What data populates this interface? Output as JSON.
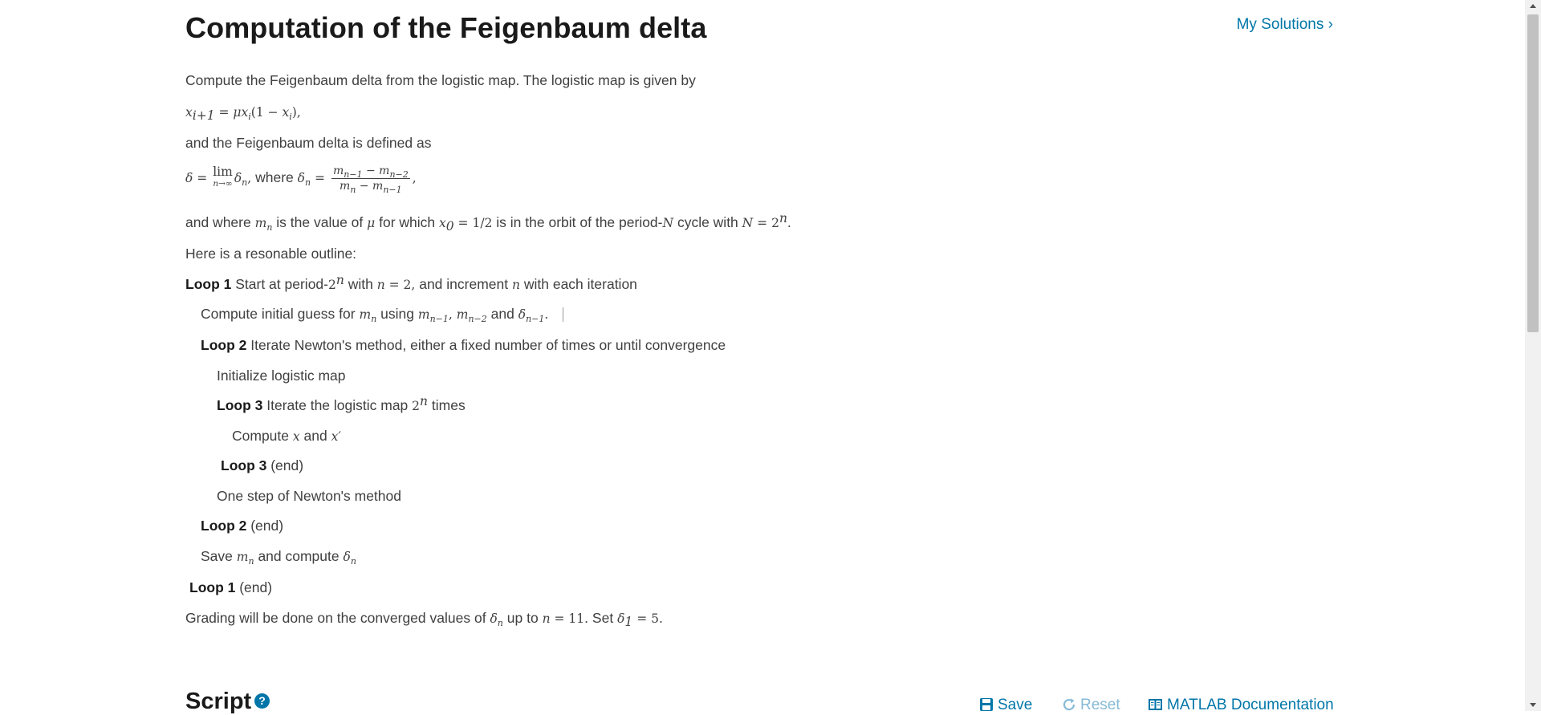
{
  "title": "Computation of the Feigenbaum delta",
  "my_solutions": "My Solutions",
  "my_solutions_chevron": "›",
  "intro": "Compute the Feigenbaum delta from the logistic map.  The logistic map is given by",
  "defined_as": "and the Feigenbaum delta is defined as",
  "where": "where",
  "and_where": "and where",
  "is_value_of": "is the value of",
  "for_which": "for which",
  "in_orbit": "is in the orbit of the period-",
  "cycle_with": "cycle with",
  "outline": "Here is a resonable outline:",
  "loop1_label": "Loop 1",
  "loop1_text_a": "Start at period-",
  "loop1_text_b": "with",
  "loop1_text_c": "and increment",
  "loop1_text_d": "with each iteration",
  "initial_guess_a": "Compute initial guess for",
  "initial_guess_b": "using",
  "initial_guess_c": "and",
  "loop2_label": "Loop 2",
  "loop2_text": "Iterate Newton's method, either a fixed number of times or until convergence",
  "init_logistic": "Initialize logistic map",
  "loop3_label": "Loop 3",
  "loop3_text_a": "Iterate the logistic map",
  "loop3_text_b": "times",
  "compute_x_a": "Compute",
  "compute_x_b": "and",
  "loop3_end": "(end)",
  "newton_step": "One step of  Newton's method",
  "loop2_end": "(end)",
  "save_a": "Save",
  "save_b": "and compute",
  "loop1_end": "(end)",
  "grading_a": "Grading will be done on the converged values of",
  "grading_b": "up to",
  "grading_c": "Set",
  "script_title": "Script",
  "help_icon_glyph": "?",
  "toolbar": {
    "save": "Save",
    "reset": "Reset",
    "docs": "MATLAB Documentation"
  },
  "colors": {
    "link": "#0076a8",
    "disabled_link": "#86bad6",
    "text": "#404040",
    "heading": "#1a1a1a"
  },
  "icons": {
    "save": "floppy-disk-icon",
    "reset": "reset-arrow-icon",
    "docs": "book-icon",
    "help": "question-mark-icon",
    "chevron": "chevron-right-icon"
  }
}
